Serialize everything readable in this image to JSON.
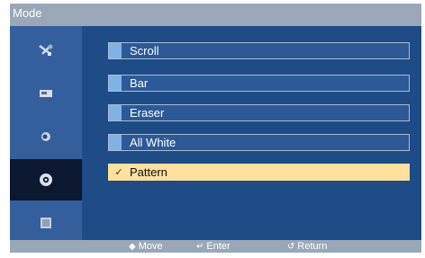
{
  "header": {
    "title": "Mode"
  },
  "sidebar": {
    "items": [
      {
        "icon": "picture-settings-icon",
        "active": false
      },
      {
        "icon": "sound-icon",
        "active": false
      },
      {
        "icon": "setup-icon",
        "active": false
      },
      {
        "icon": "multi-control-icon",
        "active": false
      },
      {
        "icon": "gear-icon",
        "active": true
      },
      {
        "icon": "support-icon",
        "active": false
      }
    ]
  },
  "menu": {
    "items": [
      {
        "label": "Scroll",
        "selected": false
      },
      {
        "label": "Bar",
        "selected": false
      },
      {
        "label": "Eraser",
        "selected": false
      },
      {
        "label": "All White",
        "selected": false
      },
      {
        "label": "Pattern",
        "selected": true,
        "check": "✓"
      }
    ]
  },
  "footer": {
    "move_glyph": "◆",
    "move_label": "Move",
    "enter_glyph": "↵",
    "enter_label": "Enter",
    "return_glyph": "↺",
    "return_label": "Return"
  },
  "colors": {
    "background": "#1e4c86",
    "title_bar": "#9aa7b7",
    "selected_item": "#ffe09c",
    "active_sidebar": "#0b1830"
  }
}
